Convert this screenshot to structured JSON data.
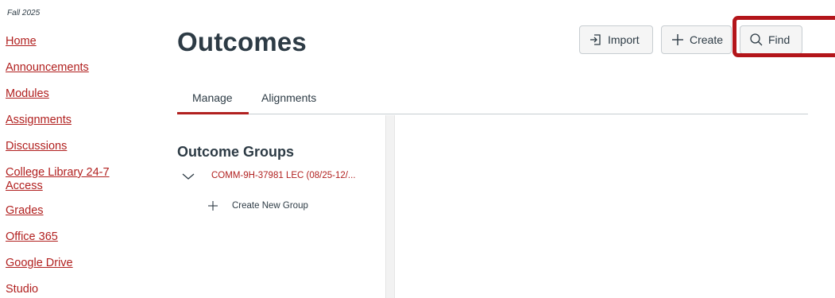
{
  "term": "Fall 2025",
  "sidebar": {
    "items": [
      {
        "label": "Home"
      },
      {
        "label": "Announcements"
      },
      {
        "label": "Modules"
      },
      {
        "label": "Assignments"
      },
      {
        "label": "Discussions"
      },
      {
        "label": "College Library 24-7 Access"
      },
      {
        "label": "Grades"
      },
      {
        "label": "Office 365"
      },
      {
        "label": "Google Drive"
      },
      {
        "label": "Studio"
      }
    ]
  },
  "header": {
    "title": "Outcomes",
    "import_label": "Import",
    "create_label": "Create",
    "find_label": "Find"
  },
  "tabs": [
    {
      "label": "Manage",
      "selected": true
    },
    {
      "label": "Alignments",
      "selected": false
    }
  ],
  "outcome_groups": {
    "title": "Outcome Groups",
    "group_name": "COMM-9H-37981 LEC (08/25-12/...",
    "create_new_label": "Create New Group"
  },
  "colors": {
    "link": "#b1201f",
    "highlight": "#b3151a",
    "text": "#2d3b45"
  }
}
